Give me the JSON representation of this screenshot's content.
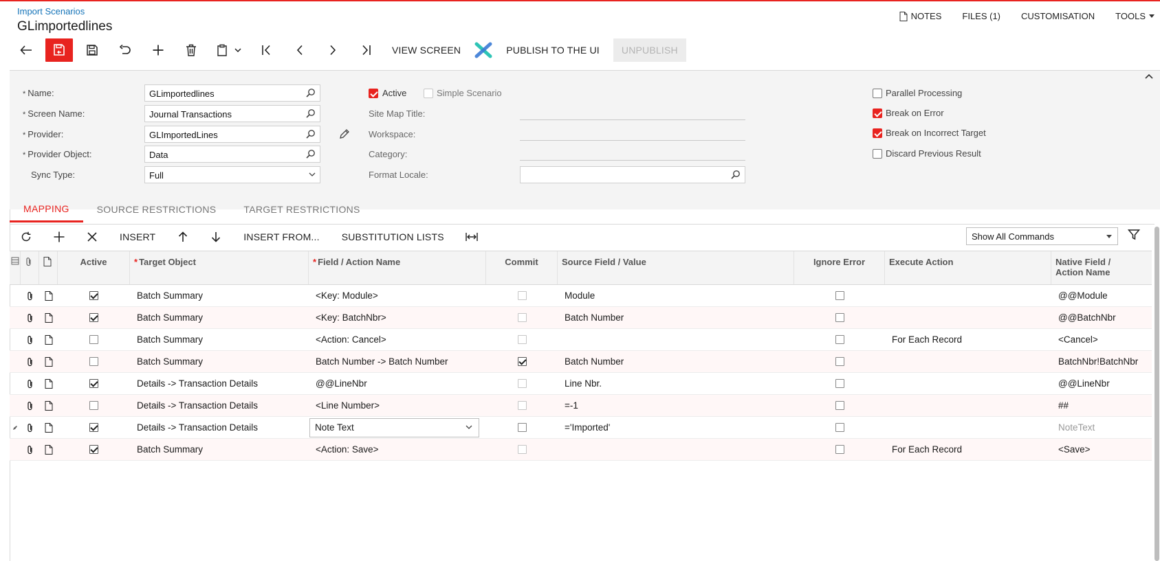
{
  "header": {
    "breadcrumb": "Import Scenarios",
    "title": "GLimportedlines"
  },
  "top_right": {
    "notes": "NOTES",
    "files": "FILES (1)",
    "customisation": "CUSTOMISATION",
    "tools": "TOOLS"
  },
  "toolbar": {
    "view_screen": "VIEW SCREEN",
    "publish": "PUBLISH TO THE UI",
    "unpublish": "UNPUBLISH"
  },
  "form": {
    "name_label": "Name:",
    "name_value": "GLimportedlines",
    "screen_name_label": "Screen Name:",
    "screen_name_value": "Journal Transactions",
    "provider_label": "Provider:",
    "provider_value": "GLImportedLines",
    "provider_object_label": "Provider Object:",
    "provider_object_value": "Data",
    "sync_type_label": "Sync Type:",
    "sync_type_value": "Full",
    "active_label": "Active",
    "simple_scenario_label": "Simple Scenario",
    "site_map_title_label": "Site Map Title:",
    "workspace_label": "Workspace:",
    "category_label": "Category:",
    "format_locale_label": "Format Locale:",
    "parallel_processing_label": "Parallel Processing",
    "break_on_error_label": "Break on Error",
    "break_on_incorrect_target_label": "Break on Incorrect Target",
    "discard_previous_result_label": "Discard Previous Result",
    "active": true,
    "simple_scenario": false,
    "parallel_processing": false,
    "break_on_error": true,
    "break_on_incorrect_target": true,
    "discard_previous_result": false
  },
  "tabs": [
    {
      "label": "MAPPING",
      "active": true
    },
    {
      "label": "SOURCE RESTRICTIONS",
      "active": false
    },
    {
      "label": "TARGET RESTRICTIONS",
      "active": false
    }
  ],
  "grid_toolbar": {
    "insert": "INSERT",
    "insert_from": "INSERT FROM...",
    "substitution_lists": "SUBSTITUTION LISTS",
    "commands_select": "Show All Commands"
  },
  "grid": {
    "headers": {
      "active": "Active",
      "target_object": "Target Object",
      "field_action": "Field / Action Name",
      "commit": "Commit",
      "source_field": "Source Field / Value",
      "ignore_error": "Ignore Error",
      "execute_action": "Execute Action",
      "native_field_1": "Native Field /",
      "native_field_2": "Action Name"
    },
    "rows": [
      {
        "active": true,
        "target": "Batch Summary",
        "field": "<Key: Module>",
        "commit": false,
        "source": "Module",
        "ignore": false,
        "execute": "",
        "native": "@@Module"
      },
      {
        "active": true,
        "target": "Batch Summary",
        "field": "<Key: BatchNbr>",
        "commit": false,
        "source": "Batch Number",
        "ignore": false,
        "execute": "",
        "native": "@@BatchNbr"
      },
      {
        "active": false,
        "target": "Batch Summary",
        "field": "<Action: Cancel>",
        "commit": false,
        "source": "",
        "ignore": false,
        "execute": "For Each Record",
        "native": "<Cancel>"
      },
      {
        "active": false,
        "target": "Batch Summary",
        "field": "Batch Number -> Batch Number",
        "commit": true,
        "source": "Batch Number",
        "ignore": false,
        "execute": "",
        "native": "BatchNbr!BatchNbr"
      },
      {
        "active": true,
        "target": "Details -> Transaction Details",
        "field": "@@LineNbr",
        "commit": false,
        "source": "Line Nbr.",
        "ignore": false,
        "execute": "",
        "native": "@@LineNbr"
      },
      {
        "active": false,
        "target": "Details -> Transaction Details",
        "field": "<Line Number>",
        "commit": false,
        "source": "=-1",
        "ignore": false,
        "execute": "",
        "native": "##"
      },
      {
        "active": true,
        "target": "Details -> Transaction Details",
        "field": "Note Text",
        "commit": false,
        "source": "='Imported'",
        "ignore": false,
        "execute": "",
        "native": "NoteText"
      },
      {
        "active": true,
        "target": "Batch Summary",
        "field": "<Action: Save>",
        "commit": false,
        "source": "",
        "ignore": false,
        "execute": "For Each Record",
        "native": "<Save>"
      }
    ]
  }
}
